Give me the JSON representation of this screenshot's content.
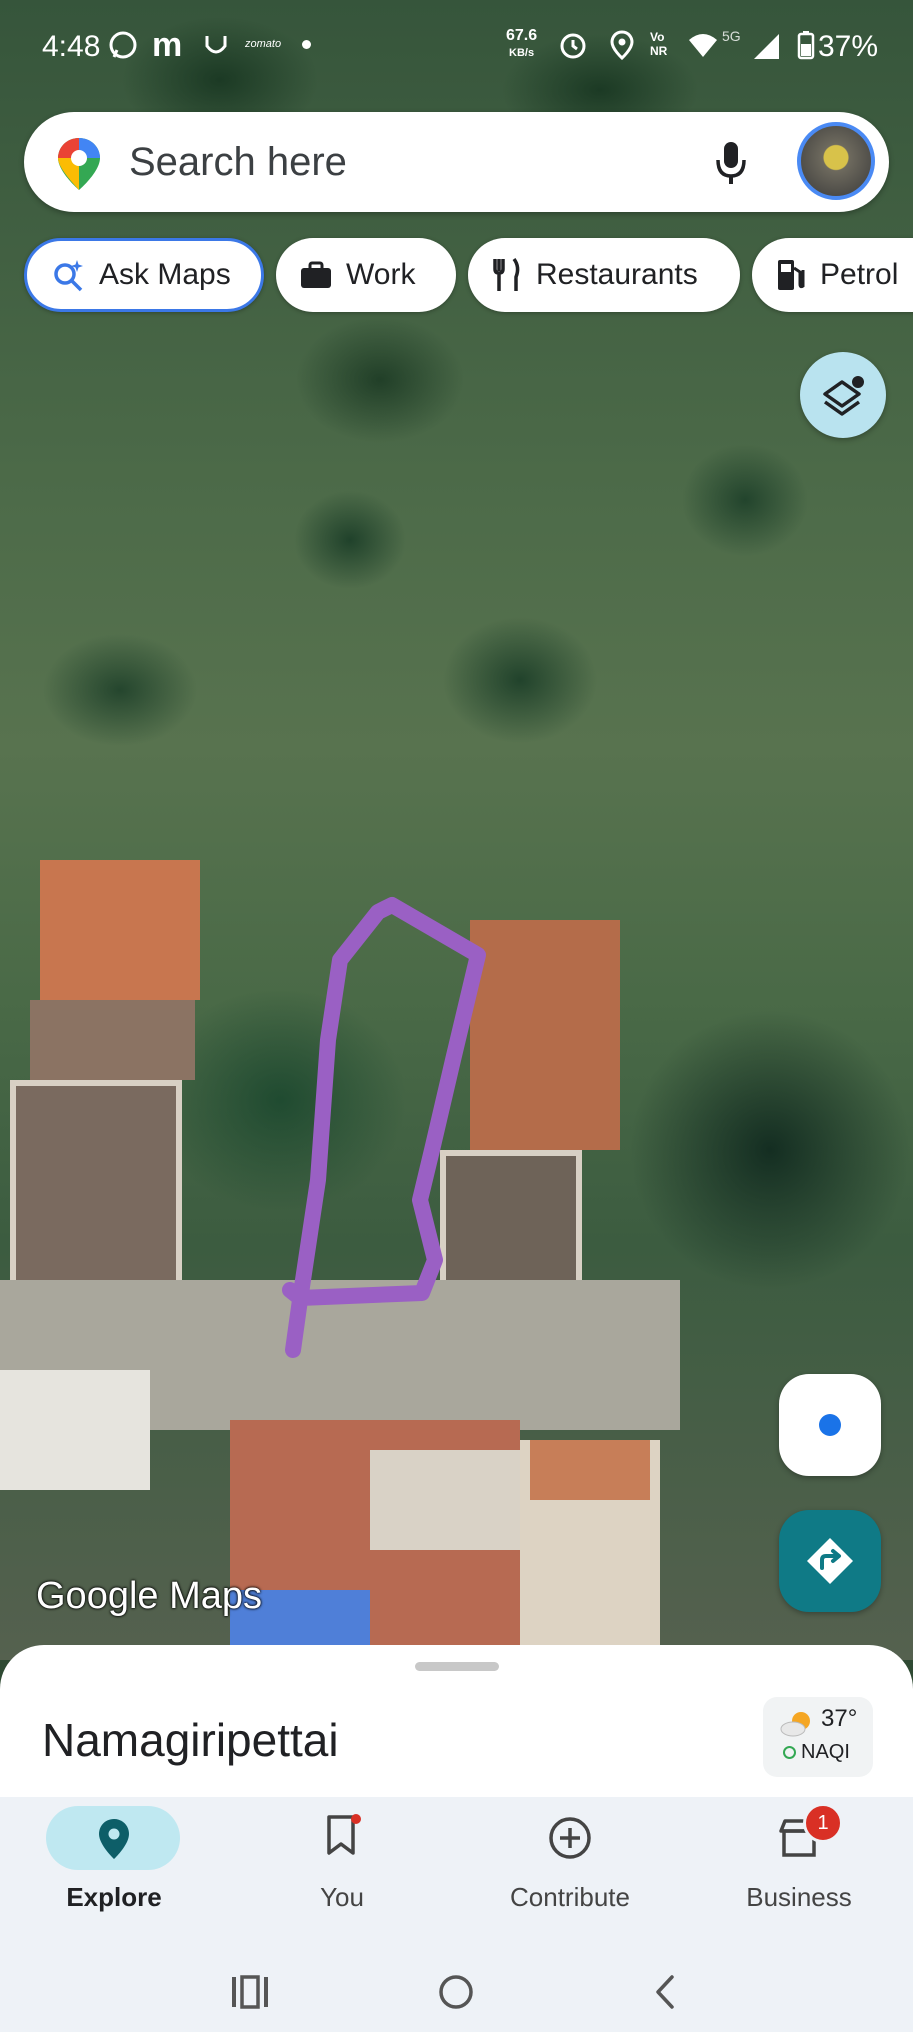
{
  "status_bar": {
    "time": "4:48",
    "net_speed": "67.6",
    "net_unit": "KB/s",
    "volte": "Vo\nNR",
    "network": "5G",
    "battery": "37%",
    "icons": [
      "whatsapp-icon",
      "m-icon",
      "notification-icon",
      "zomato-icon",
      "dot-icon",
      "alarm-icon",
      "location-icon",
      "wifi-icon",
      "signal-icon",
      "battery-icon"
    ]
  },
  "search": {
    "placeholder": "Search here"
  },
  "chips": [
    {
      "label": "Ask Maps",
      "icon": "sparkle-search-icon"
    },
    {
      "label": "Work",
      "icon": "briefcase-icon"
    },
    {
      "label": "Restaurants",
      "icon": "fork-knife-icon"
    },
    {
      "label": "Petrol",
      "icon": "fuel-icon"
    }
  ],
  "map": {
    "watermark": "Google Maps"
  },
  "sheet": {
    "place": "Namagiripettai",
    "weather": {
      "temp": "37°",
      "aqi": "NAQI",
      "icon": "partly-sunny-icon"
    }
  },
  "nav": [
    {
      "label": "Explore",
      "icon": "pin-icon",
      "selected": true
    },
    {
      "label": "You",
      "icon": "bookmark-icon"
    },
    {
      "label": "Contribute",
      "icon": "add-circle-icon"
    },
    {
      "label": "Business",
      "icon": "store-icon",
      "badge": "1"
    }
  ],
  "colors": {
    "accent": "#3b78e7",
    "drawing": "#9a60c4",
    "directions": "#0f7a86",
    "nav_selected": "#bfe8f1"
  }
}
